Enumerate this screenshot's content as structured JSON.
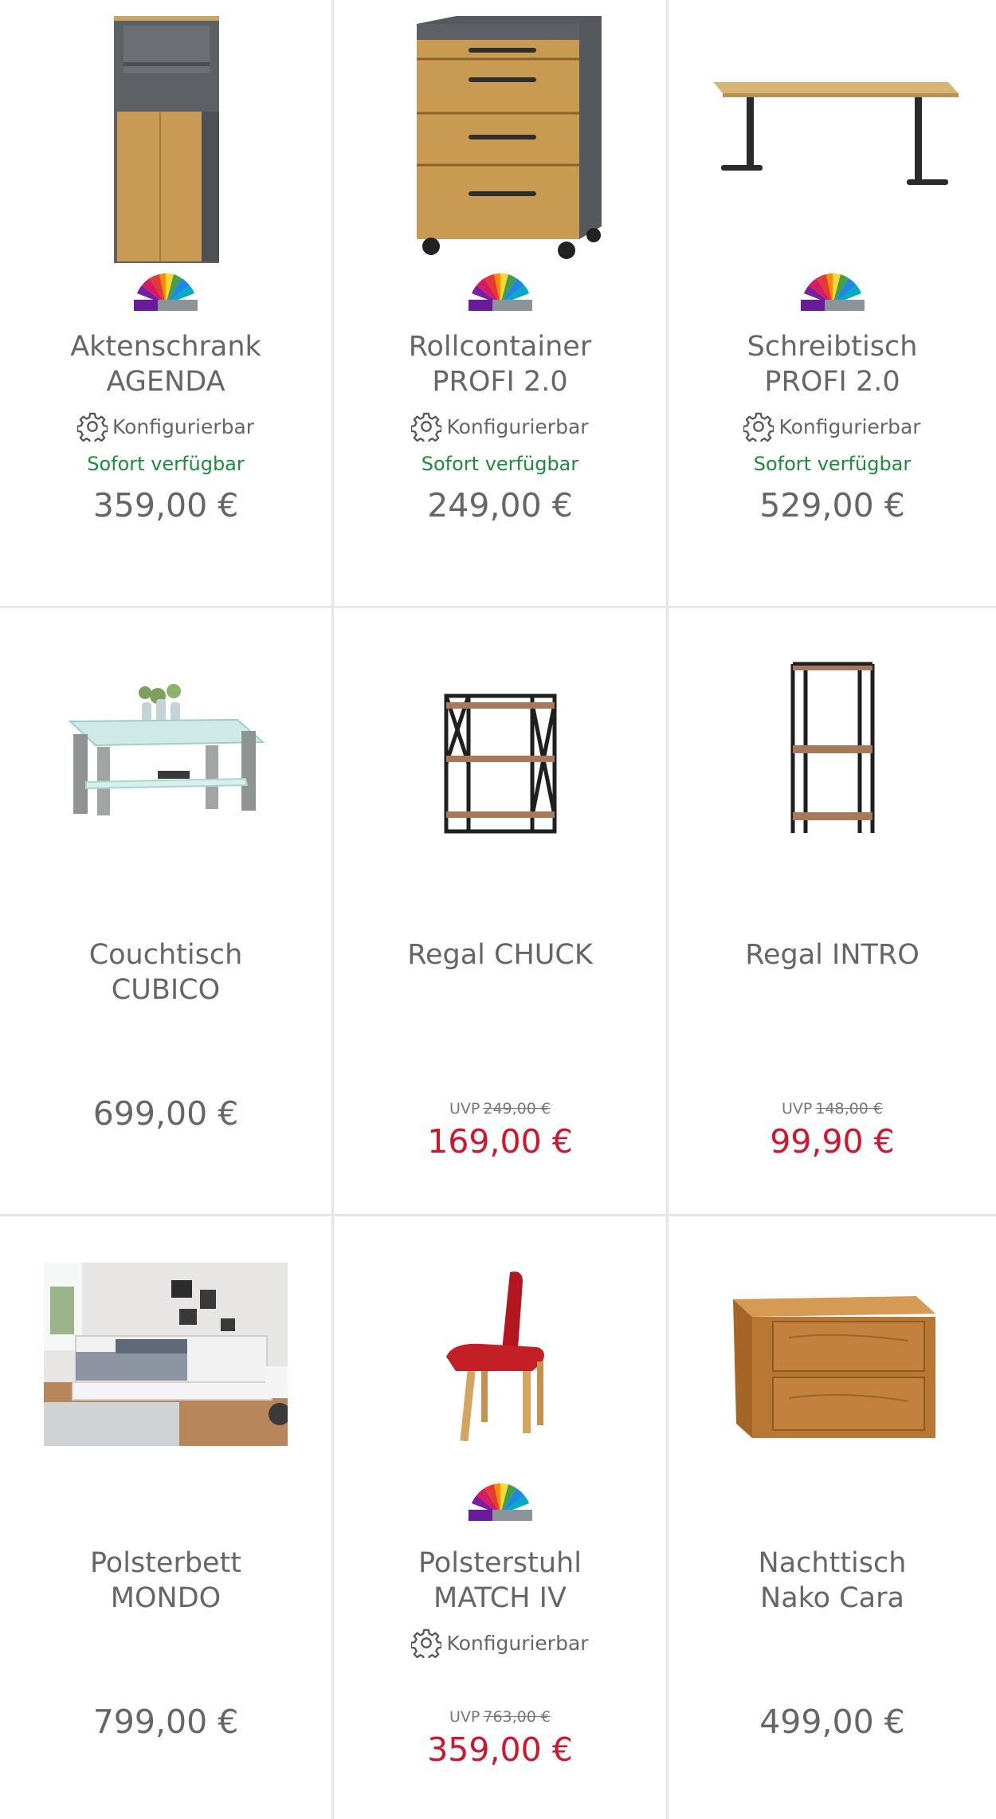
{
  "products": [
    {
      "name_line1": "Aktenschrank",
      "name_line2": "AGENDA",
      "configurable": "Konfigurierbar",
      "availability": "Sofort verfügbar",
      "price": "359,00 €"
    },
    {
      "name_line1": "Rollcontainer",
      "name_line2": "PROFI 2.0",
      "configurable": "Konfigurierbar",
      "availability": "Sofort verfügbar",
      "price": "249,00 €"
    },
    {
      "name_line1": "Schreibtisch",
      "name_line2": "PROFI 2.0",
      "configurable": "Konfigurierbar",
      "availability": "Sofort verfügbar",
      "price": "529,00 €"
    },
    {
      "name_line1": "Couchtisch",
      "name_line2": "CUBICO",
      "price": "699,00 €"
    },
    {
      "name_line1": "Regal CHUCK",
      "uvp_label": "UVP",
      "uvp_price": "249,00 €",
      "sale_price": "169,00 €"
    },
    {
      "name_line1": "Regal INTRO",
      "uvp_label": "UVP",
      "uvp_price": "148,00 €",
      "sale_price": "99,90 €"
    },
    {
      "name_line1": "Polsterbett",
      "name_line2": "MONDO",
      "price": "799,00 €"
    },
    {
      "name_line1": "Polsterstuhl",
      "name_line2": "MATCH IV",
      "configurable": "Konfigurierbar",
      "uvp_label": "UVP",
      "uvp_price": "763,00 €",
      "sale_price": "359,00 €"
    },
    {
      "name_line1": "Nachttisch",
      "name_line2": "Nako Cara",
      "price": "499,00 €"
    }
  ],
  "icons": {
    "brand": "rainbow-fan-logo-icon",
    "configure": "gear-icon"
  },
  "colors": {
    "available": "#1e8a3c",
    "sale": "#d2142c",
    "text": "#666666",
    "divider": "#e6e6e6"
  }
}
